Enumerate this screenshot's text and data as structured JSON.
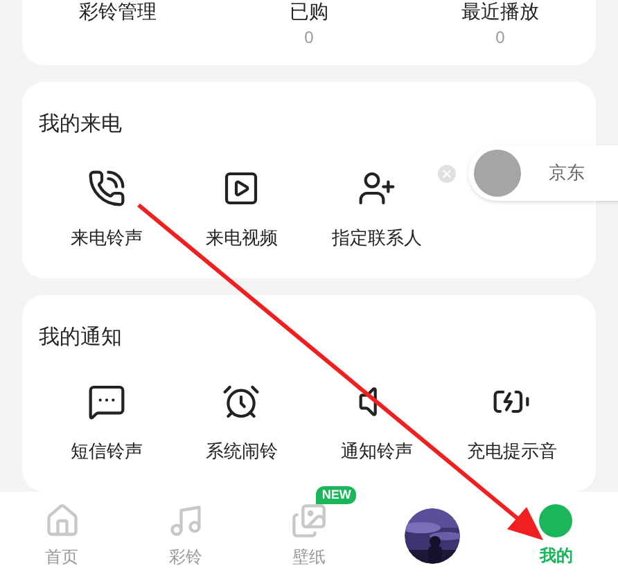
{
  "summary": [
    {
      "label": "彩铃管理"
    },
    {
      "label": "已购",
      "count": "0"
    },
    {
      "label": "最近播放",
      "count": "0"
    }
  ],
  "sections": [
    {
      "title": "我的来电",
      "items": [
        {
          "label": "来电铃声",
          "kind": "phone"
        },
        {
          "label": "来电视频",
          "kind": "video"
        },
        {
          "label": "指定联系人",
          "kind": "contact"
        }
      ]
    },
    {
      "title": "我的通知",
      "items": [
        {
          "label": "短信铃声",
          "kind": "message"
        },
        {
          "label": "系统闹铃",
          "kind": "alarm"
        },
        {
          "label": "通知铃声",
          "kind": "speaker"
        },
        {
          "label": "充电提示音",
          "kind": "battery"
        }
      ]
    }
  ],
  "floating_ad": {
    "label": "京东"
  },
  "nav": [
    {
      "label": "首页",
      "kind": "home",
      "selected": false
    },
    {
      "label": "彩铃",
      "kind": "music",
      "selected": false
    },
    {
      "label": "壁纸",
      "kind": "wallpaper",
      "selected": false,
      "badge": "NEW"
    },
    {
      "kind": "picture",
      "selected": false
    },
    {
      "label": "我的",
      "kind": "mine",
      "selected": true
    }
  ]
}
